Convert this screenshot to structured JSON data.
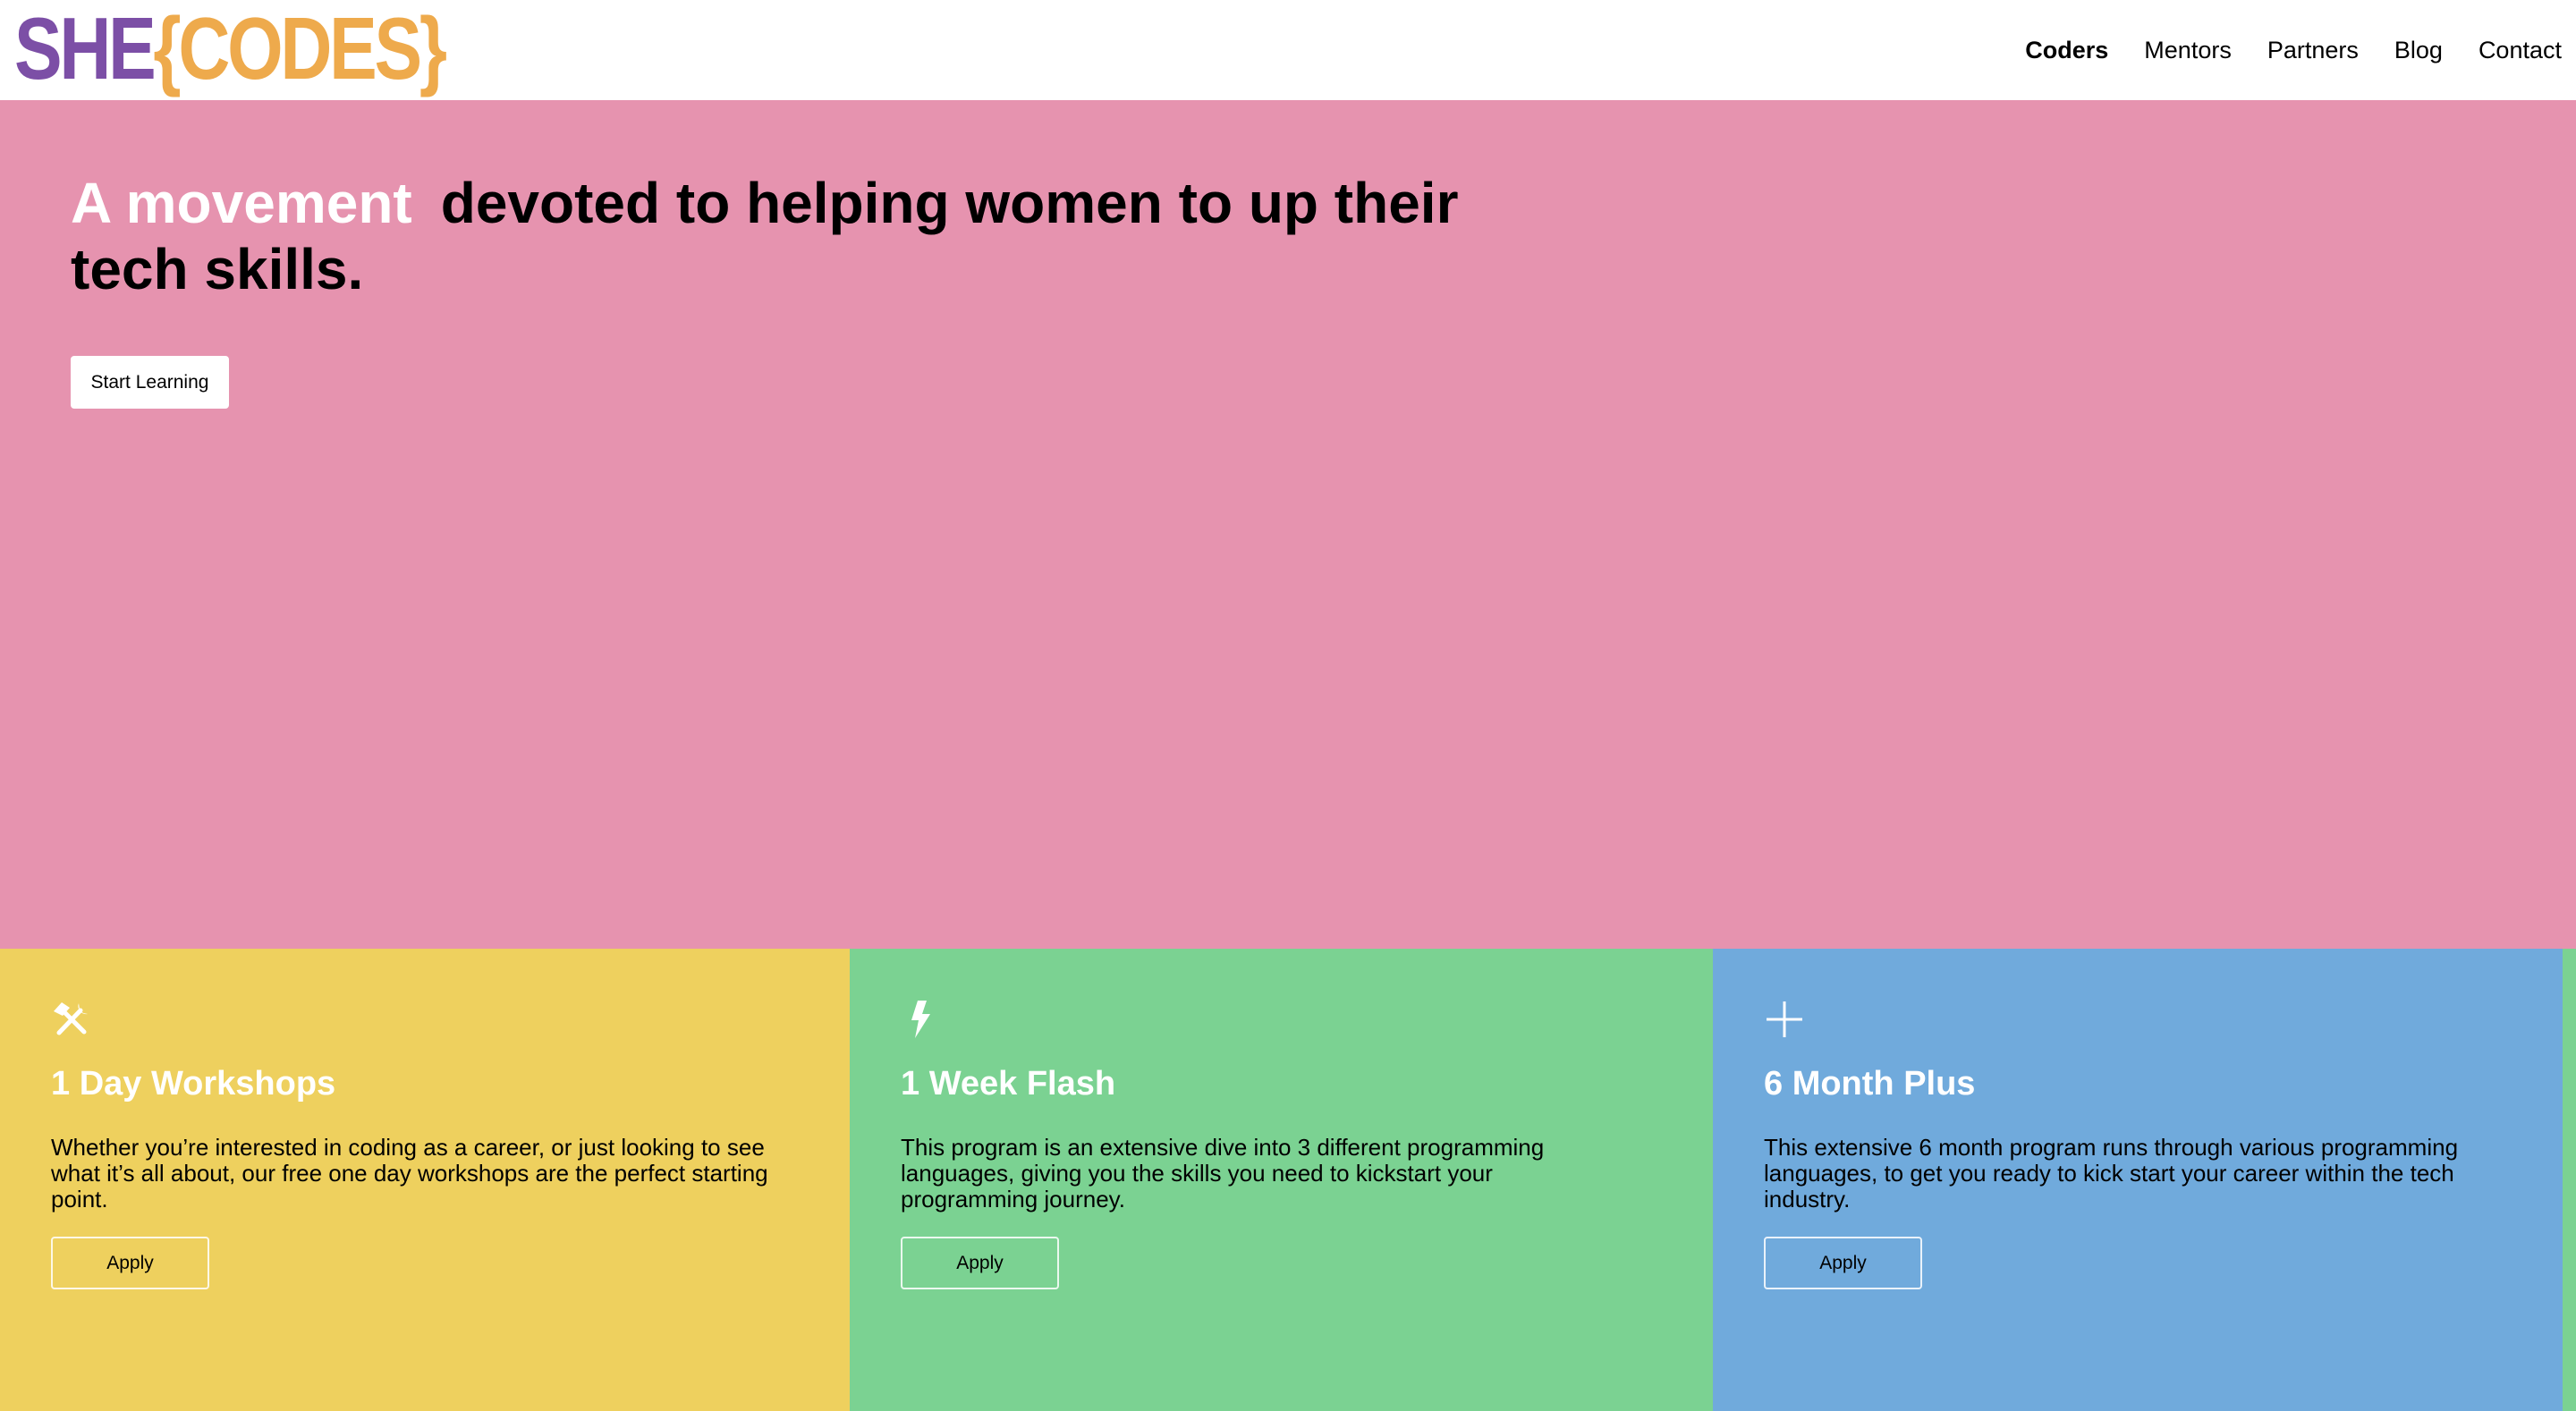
{
  "brand": {
    "logo_she": "SHE",
    "logo_codes": "{CODES}",
    "colors": {
      "purple": "#7c4fa6",
      "orange": "#eeaa4c"
    }
  },
  "nav": {
    "items": [
      {
        "label": "Coders",
        "active": true
      },
      {
        "label": "Mentors",
        "active": false
      },
      {
        "label": "Partners",
        "active": false
      },
      {
        "label": "Blog",
        "active": false
      },
      {
        "label": "Contact",
        "active": false
      }
    ]
  },
  "hero": {
    "heading_accent": "A movement",
    "heading_rest": "devoted to helping women to up their tech skills.",
    "cta_label": "Start Learning",
    "background": "#e693af"
  },
  "programs": [
    {
      "icon": "tools-icon",
      "title": "1 Day Workshops",
      "description": "Whether you’re interested in coding as a career, or just looking to see what it’s all about, our free one day workshops are the perfect starting point.",
      "button_label": "Apply",
      "color": "#eed05e"
    },
    {
      "icon": "lightning-icon",
      "title": "1 Week Flash",
      "description": "This program is an extensive dive into 3 different programming languages, giving you the skills you need to kickstart your programming journey.",
      "button_label": "Apply",
      "color": "#7bd292"
    },
    {
      "icon": "plus-icon",
      "title": "6 Month Plus",
      "description": "This extensive 6 month program runs through various programming languages, to get you ready to kick start your career within the tech industry.",
      "button_label": "Apply",
      "color": "#70aadc"
    }
  ]
}
